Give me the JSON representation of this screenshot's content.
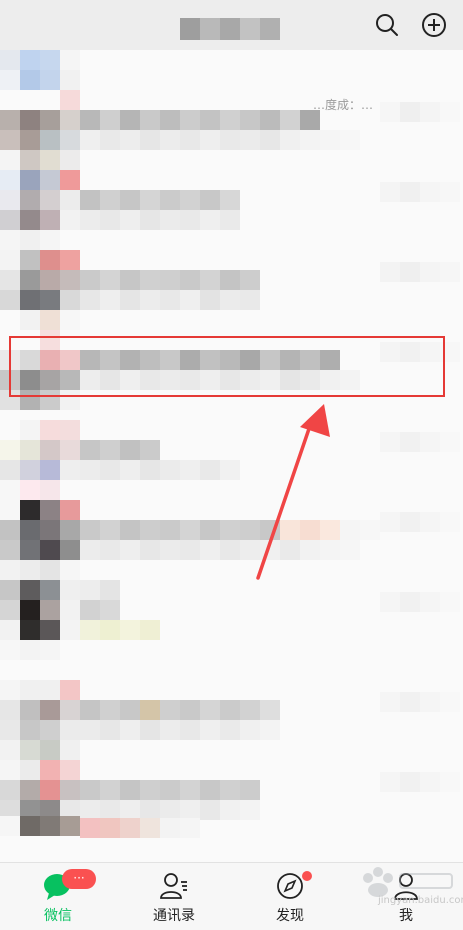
{
  "header": {
    "search_icon": "search-icon",
    "add_icon": "plus-circle-icon"
  },
  "chat_list": {
    "top_snippet": "…度成：…"
  },
  "colors": {
    "accent": "#07c160",
    "badge": "#fa5151",
    "highlight_box": "#e53935",
    "arrow": "#f04545"
  },
  "tabbar": {
    "tabs": [
      {
        "label": "微信",
        "icon": "chat-bubble-icon",
        "badge": "···"
      },
      {
        "label": "通讯录",
        "icon": "contacts-icon"
      },
      {
        "label": "发现",
        "icon": "compass-icon"
      },
      {
        "label": "我",
        "icon": "person-icon"
      }
    ]
  },
  "watermark": {
    "text": "jingyan.baidu.com"
  }
}
